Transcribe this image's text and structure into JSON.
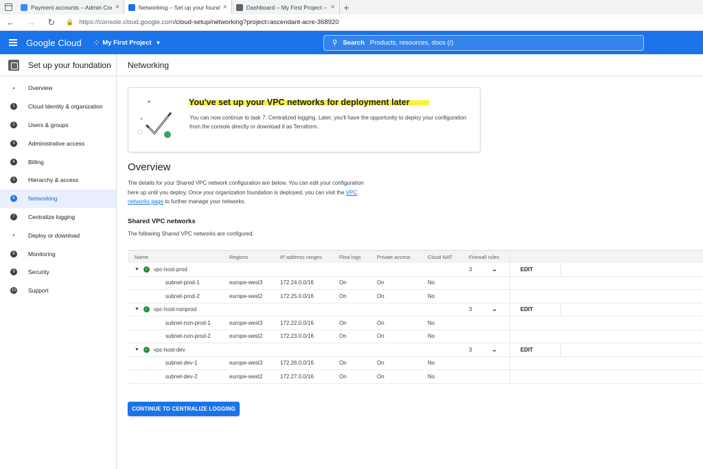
{
  "browser": {
    "tabs": [
      {
        "title": "Payment accounts – Admin Conso",
        "active": false,
        "favicon_color": "#4285f4"
      },
      {
        "title": "Networking – Set up your found",
        "active": true,
        "favicon_color": "#1a73e8"
      },
      {
        "title": "Dashboard – My First Project – G",
        "active": false,
        "favicon_color": "#5f6368"
      }
    ],
    "url_base": "https://console.cloud.google.com",
    "url_rest": "/cloud-setup/networking?project=ascendant-acre-368920"
  },
  "header": {
    "brand": "Google Cloud",
    "project": "My First Project",
    "search_label": "Search",
    "search_placeholder": "Products, resources, docs (/)"
  },
  "sidebar": {
    "title": "Set up your foundation",
    "items": [
      {
        "marker": "•",
        "label": "Overview",
        "numbered": false,
        "active": false
      },
      {
        "marker": "1",
        "label": "Cloud Identity & organization",
        "numbered": true,
        "active": false
      },
      {
        "marker": "2",
        "label": "Users & groups",
        "numbered": true,
        "active": false
      },
      {
        "marker": "3",
        "label": "Administrative access",
        "numbered": true,
        "active": false
      },
      {
        "marker": "4",
        "label": "Billing",
        "numbered": true,
        "active": false
      },
      {
        "marker": "5",
        "label": "Hierarchy & access",
        "numbered": true,
        "active": false
      },
      {
        "marker": "6",
        "label": "Networking",
        "numbered": true,
        "active": true
      },
      {
        "marker": "7",
        "label": "Centralize logging",
        "numbered": true,
        "active": false
      },
      {
        "marker": "•",
        "label": "Deploy or download",
        "numbered": false,
        "active": false
      },
      {
        "marker": "8",
        "label": "Monitoring",
        "numbered": true,
        "active": false
      },
      {
        "marker": "9",
        "label": "Security",
        "numbered": true,
        "active": false
      },
      {
        "marker": "10",
        "label": "Support",
        "numbered": true,
        "active": false
      }
    ]
  },
  "main": {
    "page_title": "Networking",
    "banner": {
      "title": "You've set up your VPC networks for deployment later",
      "text": "You can now continue to task 7: Centralized logging. Later, you'll have the opportunity to deploy your configuration from the console directly or download it as Terraform."
    },
    "overview": {
      "title": "Overview",
      "text_before_link": "The details for your Shared VPC network configuration are below. You can edit your configuration here up until you deploy. Once your organization foundation is deployed, you can visit the ",
      "link": "VPC networks page",
      "text_after_link": " to further manage your networks."
    },
    "shared_vpc": {
      "title": "Shared VPC networks",
      "subtitle": "The following Shared VPC networks are configured."
    },
    "table": {
      "columns": {
        "name": "Name",
        "regions": "Regions",
        "ip": "IP address ranges",
        "flow": "Flow logs",
        "private": "Private access",
        "nat": "Cloud NAT",
        "firewall": "Firewall rules"
      },
      "hosts": [
        {
          "name": "vpc-host-prod",
          "firewall": "3",
          "edit": "EDIT",
          "subnets": [
            {
              "name": "subnet-prod-1",
              "region": "europe-west3",
              "ip": "172.24.0.0/16",
              "flow": "On",
              "private": "On",
              "nat": "No"
            },
            {
              "name": "subnet-prod-2",
              "region": "europe-west2",
              "ip": "172.25.0.0/16",
              "flow": "On",
              "private": "On",
              "nat": "No"
            }
          ]
        },
        {
          "name": "vpc-host-nonprod",
          "firewall": "3",
          "edit": "EDIT",
          "subnets": [
            {
              "name": "subnet-non-prod-1",
              "region": "europe-west3",
              "ip": "172.22.0.0/16",
              "flow": "On",
              "private": "On",
              "nat": "No"
            },
            {
              "name": "subnet-non-prod-2",
              "region": "europe-west2",
              "ip": "172.23.0.0/16",
              "flow": "On",
              "private": "On",
              "nat": "No"
            }
          ]
        },
        {
          "name": "vpc-host-dev",
          "firewall": "3",
          "edit": "EDIT",
          "subnets": [
            {
              "name": "subnet-dev-1",
              "region": "europe-west3",
              "ip": "172.26.0.0/16",
              "flow": "On",
              "private": "On",
              "nat": "No"
            },
            {
              "name": "subnet-dev-2",
              "region": "europe-west2",
              "ip": "172.27.0.0/16",
              "flow": "On",
              "private": "On",
              "nat": "No"
            }
          ]
        }
      ]
    },
    "cta_label": "CONTINUE TO CENTRALIZE LOGGING"
  },
  "colors": {
    "accent": "#1a73e8",
    "success": "#1e8e3e",
    "highlight": "#ffef3a"
  }
}
